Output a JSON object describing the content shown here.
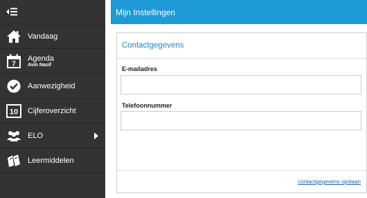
{
  "sidebar": {
    "toggle_icon": "collapse-menu-icon",
    "items": [
      {
        "label": "Vandaag",
        "sub": "",
        "icon": "home-icon"
      },
      {
        "label": "Agenda",
        "sub": "Avin Nasif",
        "icon": "calendar-icon"
      },
      {
        "label": "Aanwezigheid",
        "sub": "",
        "icon": "check-circle-icon"
      },
      {
        "label": "Cijferoverzicht",
        "sub": "",
        "icon": "grade-10-icon"
      },
      {
        "label": "ELO",
        "sub": "",
        "icon": "people-icon"
      },
      {
        "label": "Leermiddelen",
        "sub": "",
        "icon": "books-icon"
      }
    ],
    "calendar_day": "7",
    "grade_number": "10"
  },
  "header": {
    "title": "Mijn Instellingen"
  },
  "panel": {
    "title": "Contactgegevens",
    "email_label": "E-mailadres",
    "email_value": "",
    "phone_label": "Telefoonnummer",
    "phone_value": "",
    "save_link": "contactgegevens opslaan"
  },
  "colors": {
    "sidebar_bg": "#333333",
    "header_bg": "#1e9ad6",
    "accent_text": "#1e88c8"
  }
}
